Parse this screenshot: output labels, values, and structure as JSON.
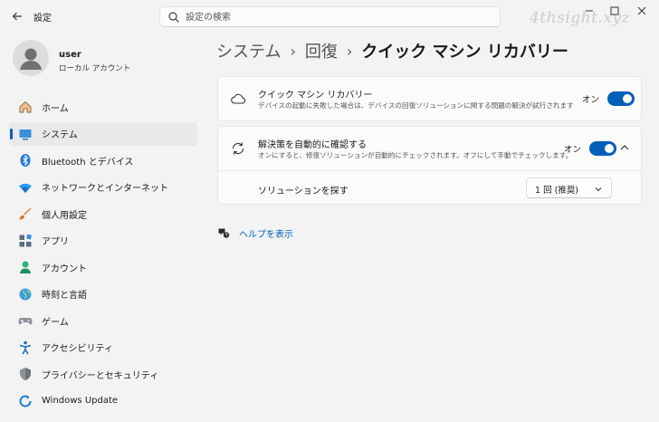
{
  "window": {
    "title": "設定",
    "watermark": "4thsight.xyz"
  },
  "search": {
    "placeholder": "設定の検索"
  },
  "profile": {
    "name": "user",
    "account_type": "ローカル アカウント"
  },
  "sidebar": {
    "items": [
      {
        "label": "ホーム",
        "icon": "home-icon"
      },
      {
        "label": "システム",
        "icon": "system-icon",
        "active": true
      },
      {
        "label": "Bluetooth とデバイス",
        "icon": "bluetooth-icon"
      },
      {
        "label": "ネットワークとインターネット",
        "icon": "network-icon"
      },
      {
        "label": "個人用設定",
        "icon": "brush-icon"
      },
      {
        "label": "アプリ",
        "icon": "apps-icon"
      },
      {
        "label": "アカウント",
        "icon": "account-icon"
      },
      {
        "label": "時刻と言語",
        "icon": "globe-icon"
      },
      {
        "label": "ゲーム",
        "icon": "gamepad-icon"
      },
      {
        "label": "アクセシビリティ",
        "icon": "accessibility-icon"
      },
      {
        "label": "プライバシーとセキュリティ",
        "icon": "shield-icon"
      },
      {
        "label": "Windows Update",
        "icon": "update-icon"
      }
    ]
  },
  "breadcrumb": {
    "level1": "システム",
    "level2": "回復",
    "current": "クイック マシン リカバリー",
    "separator": "›"
  },
  "settings": {
    "quick_recovery": {
      "title": "クイック マシン リカバリー",
      "description": "デバイスの起動に失敗した場合は、デバイスの回復ソリューションに関する問題の解決が試行されます",
      "toggle_label": "オン",
      "enabled": true
    },
    "auto_check": {
      "title": "解決策を自動的に確認する",
      "description": "オンにすると、修復ソリューションが自動的にチェックされます。オフにして手動でチェックします。",
      "toggle_label": "オン",
      "enabled": true,
      "expanded": true
    },
    "find_solution": {
      "label": "ソリューションを探す",
      "selected": "1 回 (推奨)"
    }
  },
  "help": {
    "label": "ヘルプを表示"
  },
  "colors": {
    "accent": "#005fb8",
    "background": "#f3f3f3",
    "card": "#fbfbfb"
  }
}
